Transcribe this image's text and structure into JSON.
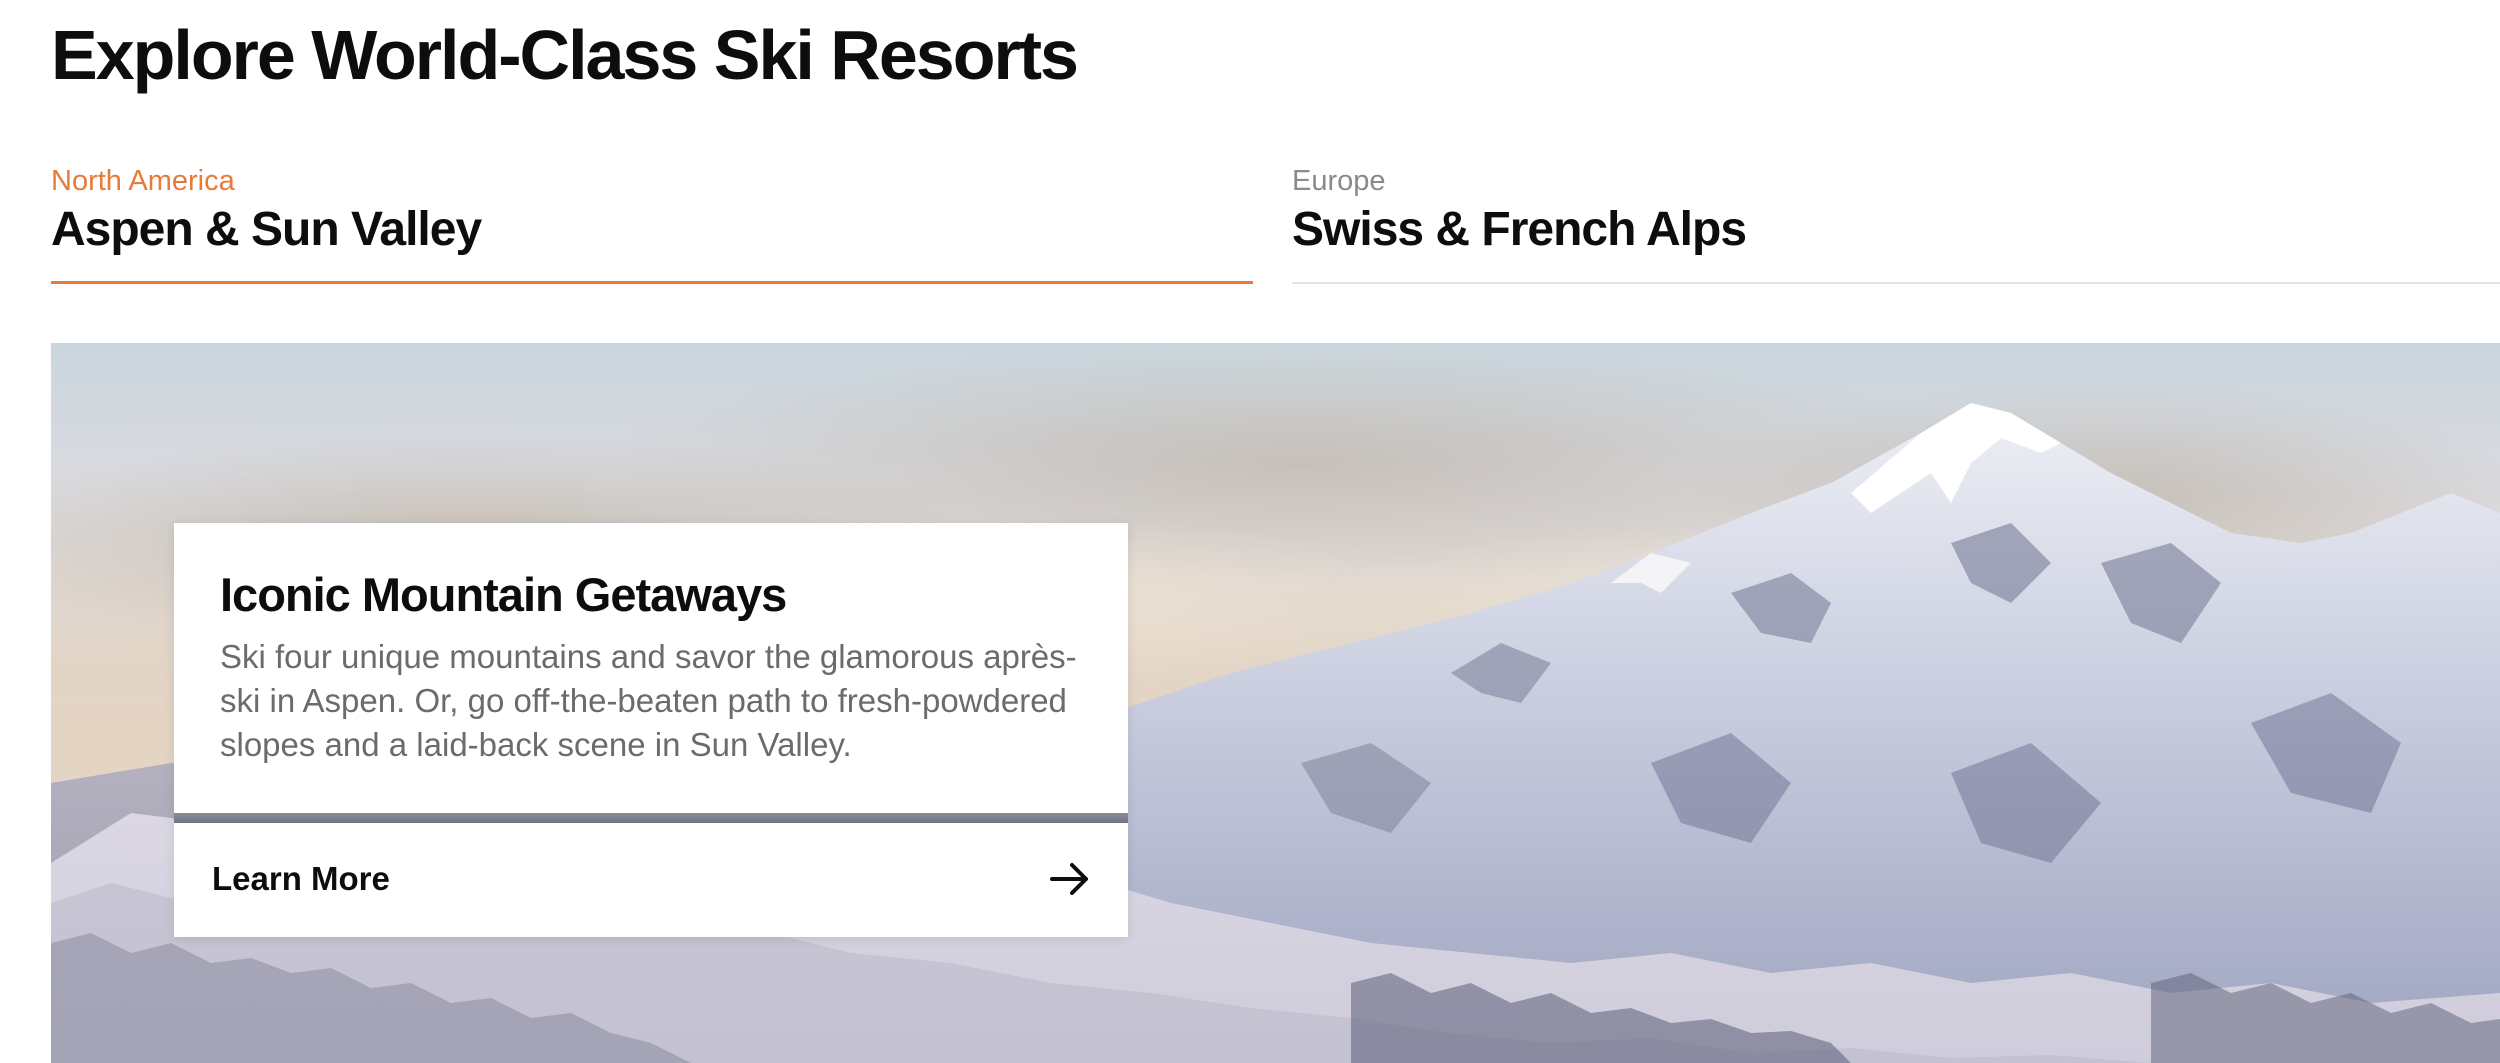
{
  "page": {
    "title": "Explore World-Class Ski Resorts"
  },
  "tabs": [
    {
      "region": "North America",
      "name": "Aspen & Sun Valley",
      "active": true
    },
    {
      "region": "Europe",
      "name": "Swiss & French Alps",
      "active": false
    }
  ],
  "hero": {
    "image": "snowy-mountain-range-photo"
  },
  "card": {
    "title": "Iconic Mountain Getaways",
    "text": "Ski four unique mountains and savor the glamorous après-ski in Aspen. Or, go off-the-beaten path to fresh-powdered slopes and a laid-back scene in Sun Valley.",
    "cta_label": "Learn More",
    "cta_icon": "arrow-right-icon"
  },
  "colors": {
    "accent": "#e87a3a",
    "inactive_region": "#8a8a8a",
    "divider": "#e3e3e3"
  }
}
